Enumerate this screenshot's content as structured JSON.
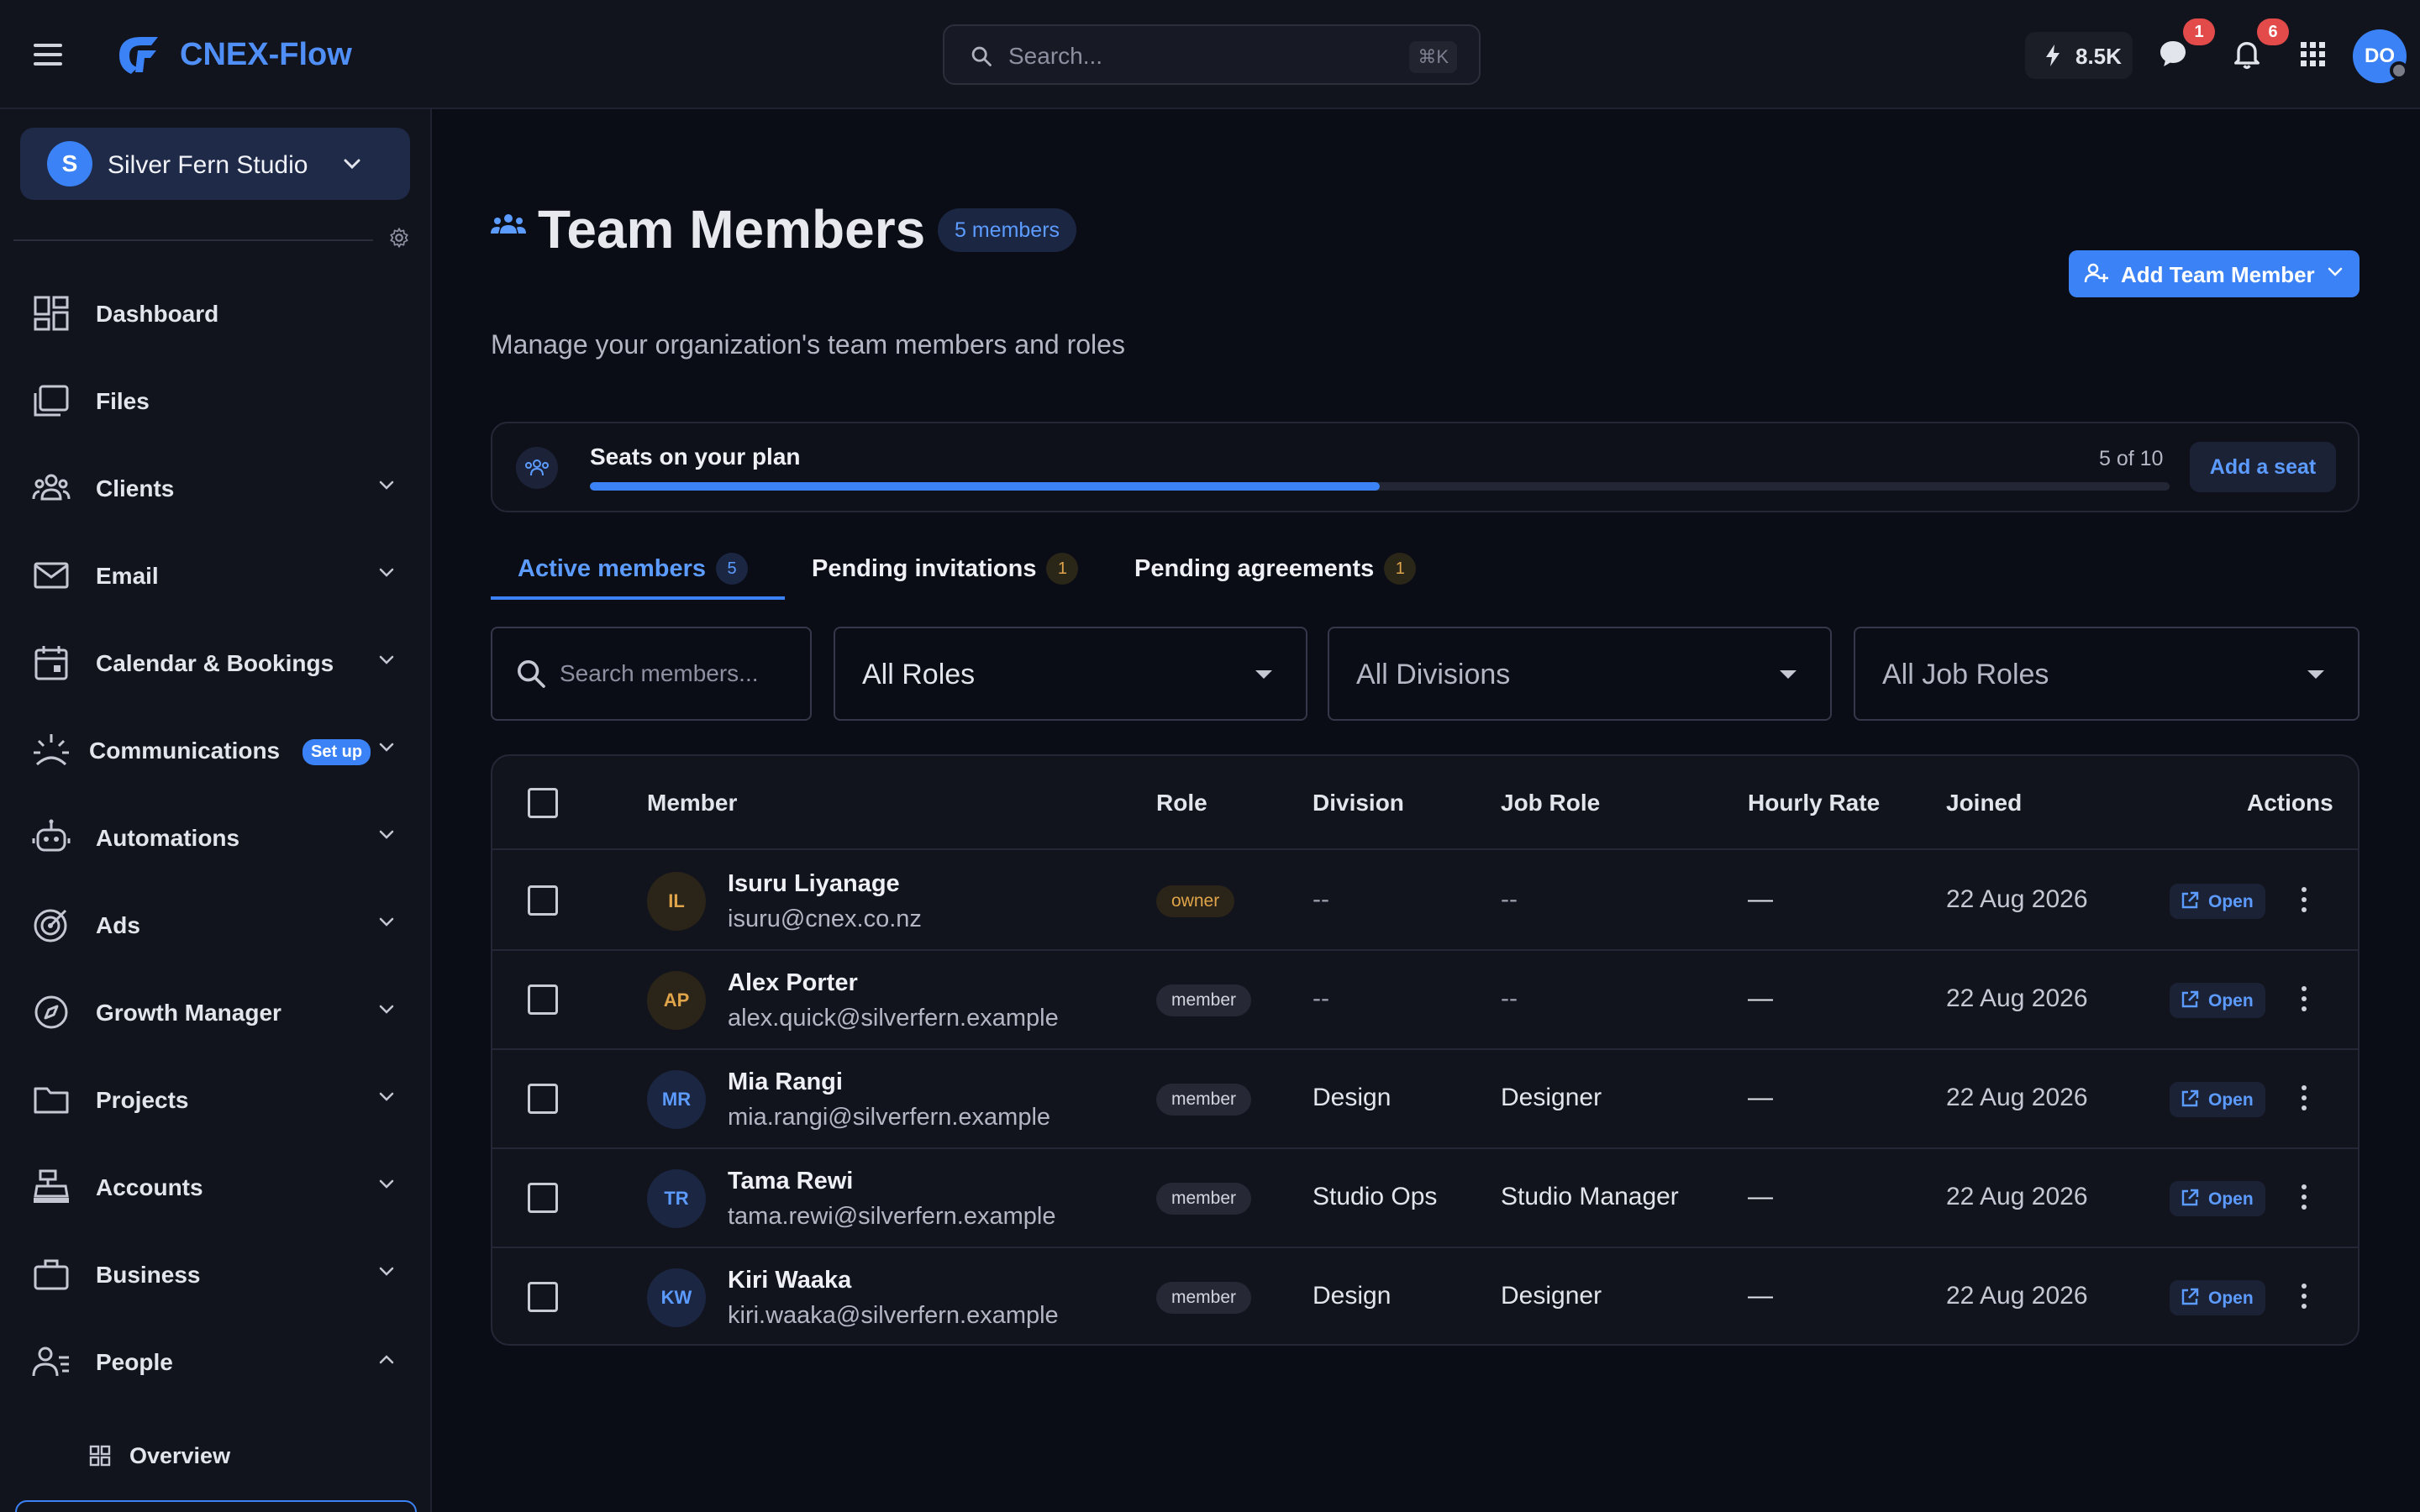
{
  "app": {
    "name": "CNEX-Flow"
  },
  "topbar": {
    "search_placeholder": "Search...",
    "search_shortcut": "⌘K",
    "credits": "8.5K",
    "messages_count": "1",
    "notifications_count": "6",
    "user_initials": "DO"
  },
  "sidebar": {
    "org_initial": "S",
    "org_name": "Silver Fern Studio",
    "items": [
      {
        "label": "Dashboard"
      },
      {
        "label": "Files"
      },
      {
        "label": "Clients"
      },
      {
        "label": "Email"
      },
      {
        "label": "Calendar & Bookings"
      },
      {
        "label": "Communications",
        "badge": "Set up"
      },
      {
        "label": "Automations"
      },
      {
        "label": "Ads"
      },
      {
        "label": "Growth Manager"
      },
      {
        "label": "Projects"
      },
      {
        "label": "Accounts"
      },
      {
        "label": "Business"
      },
      {
        "label": "People"
      }
    ],
    "sub_items": [
      {
        "label": "Overview"
      }
    ]
  },
  "page": {
    "title": "Team Members",
    "count_pill": "5 members",
    "subtitle": "Manage your organization's team members and roles",
    "add_button": "Add Team Member"
  },
  "seats": {
    "label": "Seats on your plan",
    "count": "5 of 10",
    "used_fraction": 0.5,
    "button": "Add a seat"
  },
  "tabs": [
    {
      "label": "Active members",
      "count": "5"
    },
    {
      "label": "Pending invitations",
      "count": "1"
    },
    {
      "label": "Pending agreements",
      "count": "1"
    }
  ],
  "filters": {
    "search_placeholder": "Search members...",
    "roles": "All Roles",
    "divisions": "All Divisions",
    "job_roles": "All Job Roles"
  },
  "table": {
    "headers": {
      "member": "Member",
      "role": "Role",
      "division": "Division",
      "job_role": "Job Role",
      "hourly_rate": "Hourly Rate",
      "joined": "Joined",
      "actions": "Actions"
    },
    "open_label": "Open",
    "rows": [
      {
        "initials": "IL",
        "name": "Isuru Liyanage",
        "email": "isuru@cnex.co.nz",
        "role": "owner",
        "division": "--",
        "job_role": "--",
        "rate": "—",
        "joined": "22 Aug 2026"
      },
      {
        "initials": "AP",
        "name": "Alex Porter",
        "email": "alex.quick@silverfern.example",
        "role": "member",
        "division": "--",
        "job_role": "--",
        "rate": "—",
        "joined": "22 Aug 2026"
      },
      {
        "initials": "MR",
        "name": "Mia Rangi",
        "email": "mia.rangi@silverfern.example",
        "role": "member",
        "division": "Design",
        "job_role": "Designer",
        "rate": "—",
        "joined": "22 Aug 2026"
      },
      {
        "initials": "TR",
        "name": "Tama Rewi",
        "email": "tama.rewi@silverfern.example",
        "role": "member",
        "division": "Studio Ops",
        "job_role": "Studio Manager",
        "rate": "—",
        "joined": "22 Aug 2026"
      },
      {
        "initials": "KW",
        "name": "Kiri Waaka",
        "email": "kiri.waaka@silverfern.example",
        "role": "member",
        "division": "Design",
        "job_role": "Designer",
        "rate": "—",
        "joined": "22 Aug 2026"
      }
    ]
  },
  "colors": {
    "accent": "#3b82f6",
    "background": "#0b0d16",
    "panel": "#12141d",
    "owner_badge": "#e0a44a",
    "notification_badge": "#e34b4b"
  }
}
